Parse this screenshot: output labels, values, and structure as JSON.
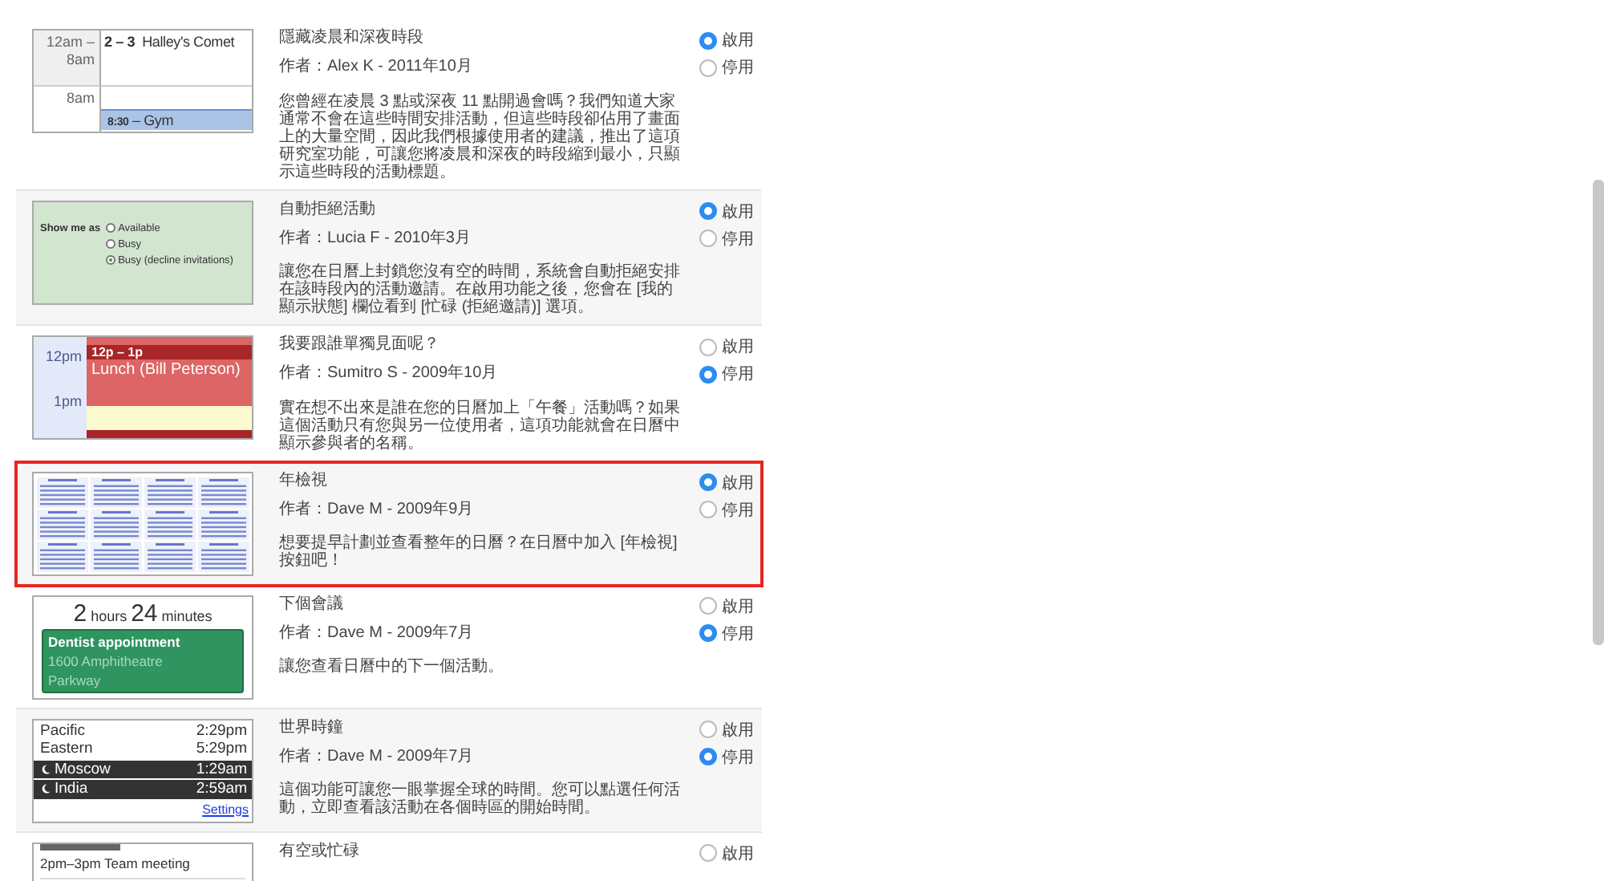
{
  "plugins": [
    {
      "title": "隱藏凌晨和深夜時段",
      "author": "作者：Alex K - 2011年10月",
      "description": "您曾經在凌晨 3 點或深夜 11 點開過會嗎？我們知道大家通常不會在這些時間安排活動，但這些時段卻佔用了畫面上的大量空間，因此我們根據使用者的建議，推出了這項研究室功能，可讓您將凌晨和深夜的時段縮到最小，只顯示這些時段的活動標題。",
      "highlighted": false,
      "options": [
        {
          "label": "啟用",
          "selected": true
        },
        {
          "label": "停用",
          "selected": false
        }
      ],
      "preview": {
        "kind": "hours",
        "range": "12am – 8am",
        "allday_time": "2 – 3",
        "allday_title": "Halley's Comet",
        "hour": "8am",
        "event_time": "8:30",
        "event_title": "– Gym"
      }
    },
    {
      "title": "自動拒絕活動",
      "author": "作者：Lucia F - 2010年3月",
      "description": "讓您在日曆上封鎖您沒有空的時間，系統會自動拒絕安排在該時段內的活動邀請。在啟用功能之後，您會在 [我的顯示狀態] 欄位看到 [忙碌 (拒絕邀請)] 選項。",
      "highlighted": false,
      "options": [
        {
          "label": "啟用",
          "selected": true
        },
        {
          "label": "停用",
          "selected": false
        }
      ],
      "preview": {
        "kind": "status",
        "label": "Show me as",
        "choices": [
          {
            "label": "Available",
            "selected": false
          },
          {
            "label": "Busy",
            "selected": false
          },
          {
            "label": "Busy (decline invitations)",
            "selected": true
          }
        ]
      }
    },
    {
      "title": "我要跟誰單獨見面呢？",
      "author": "作者：Sumitro S - 2009年10月",
      "description": "實在想不出來是誰在您的日曆加上「午餐」活動嗎？如果這個活動只有您與另一位使用者，這項功能就會在日曆中顯示參與者的名稱。",
      "highlighted": false,
      "options": [
        {
          "label": "啟用",
          "selected": false
        },
        {
          "label": "停用",
          "selected": true
        }
      ],
      "preview": {
        "kind": "lunch",
        "hour1": "12pm",
        "hour2": "1pm",
        "event_time": "12p – 1p",
        "event_title": "Lunch (Bill Peterson)"
      }
    },
    {
      "title": "年檢視",
      "author": "作者：Dave M - 2009年9月",
      "description": "想要提早計劃並查看整年的日曆？在日曆中加入 [年檢視] 按鈕吧！",
      "highlighted": true,
      "options": [
        {
          "label": "啟用",
          "selected": true
        },
        {
          "label": "停用",
          "selected": false
        }
      ],
      "preview": {
        "kind": "year"
      }
    },
    {
      "title": "下個會議",
      "author": "作者：Dave M - 2009年7月",
      "description": "讓您查看日曆中的下一個活動。",
      "highlighted": false,
      "options": [
        {
          "label": "啟用",
          "selected": false
        },
        {
          "label": "停用",
          "selected": true
        }
      ],
      "preview": {
        "kind": "countdown",
        "hours": "2",
        "hours_unit": "hours",
        "minutes": "24",
        "minutes_unit": "minutes",
        "event_title": "Dentist appointment",
        "event_place": "1600 Amphitheatre Parkway"
      }
    },
    {
      "title": "世界時鐘",
      "author": "作者：Dave M - 2009年7月",
      "description": "這個功能可讓您一眼掌握全球的時間。您可以點選任何活動，立即查看該活動在各個時區的開始時間。",
      "highlighted": false,
      "options": [
        {
          "label": "啟用",
          "selected": false
        },
        {
          "label": "停用",
          "selected": true
        }
      ],
      "preview": {
        "kind": "clocks",
        "clocks": [
          {
            "city": "Pacific",
            "time": "2:29pm",
            "night": false
          },
          {
            "city": "Eastern",
            "time": "5:29pm",
            "night": false
          },
          {
            "city": "Moscow",
            "time": "1:29am",
            "night": true
          },
          {
            "city": "India",
            "time": "2:59am",
            "night": true
          }
        ],
        "link": "Settings"
      }
    },
    {
      "title": "有空或忙碌",
      "highlighted": false,
      "options": [
        {
          "label": "啟用",
          "selected": false
        }
      ],
      "preview": {
        "kind": "meeting",
        "event": "2pm–3pm Team meeting"
      }
    }
  ]
}
